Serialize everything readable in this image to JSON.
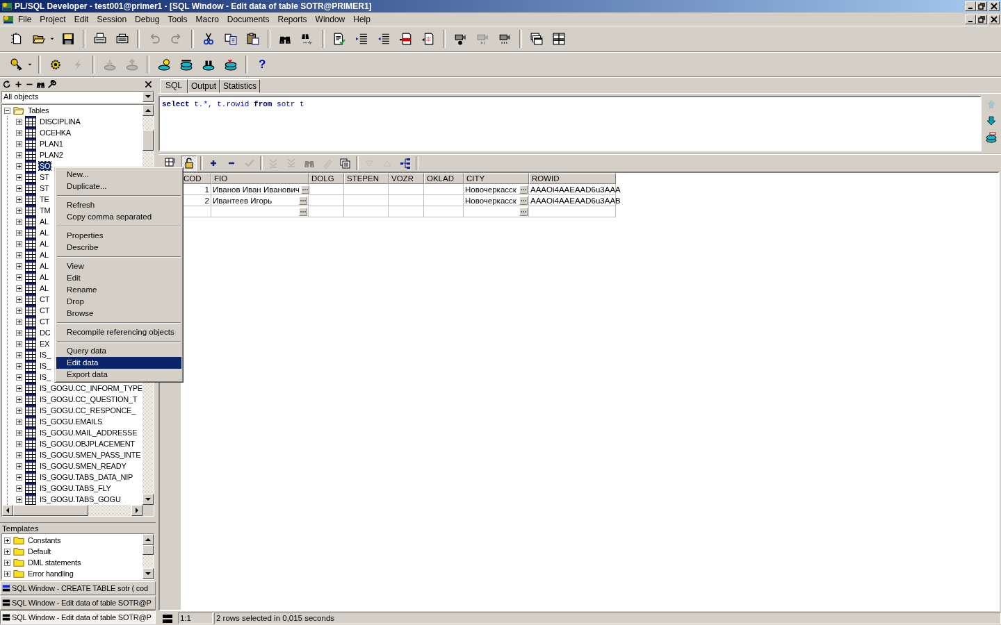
{
  "window": {
    "title": "PL/SQL Developer - test001@primer1 - [SQL Window - Edit data of table SOTR@PRIMER1]"
  },
  "menu": [
    {
      "label": "File"
    },
    {
      "label": "Project"
    },
    {
      "label": "Edit"
    },
    {
      "label": "Session"
    },
    {
      "label": "Debug"
    },
    {
      "label": "Tools"
    },
    {
      "label": "Macro"
    },
    {
      "label": "Documents"
    },
    {
      "label": "Reports"
    },
    {
      "label": "Window"
    },
    {
      "label": "Help"
    }
  ],
  "toolbar_1": [
    [
      {
        "disabled": false
      },
      {
        "disabled": false
      },
      {
        "disabled": false
      },
      {
        "disabled": false
      }
    ],
    [
      {
        "disabled": false
      },
      {
        "disabled": false
      }
    ],
    [
      {
        "disabled": true
      },
      {
        "disabled": true
      }
    ],
    [
      {
        "disabled": false
      },
      {
        "disabled": false
      },
      {
        "disabled": false
      }
    ],
    [
      {
        "disabled": false
      },
      {
        "disabled": false
      }
    ],
    [
      {
        "disabled": false
      },
      {
        "disabled": false
      },
      {
        "disabled": false
      },
      {
        "disabled": false
      },
      {
        "disabled": false
      }
    ],
    [
      {
        "disabled": false
      },
      {
        "disabled": true
      },
      {
        "disabled": false
      }
    ],
    [
      {
        "disabled": false
      },
      {
        "disabled": false
      }
    ]
  ],
  "toolbar_2": [
    [
      {
        "disabled": false
      },
      {
        "disabled": false
      }
    ],
    [
      {
        "disabled": false
      },
      {
        "disabled": true
      }
    ],
    [
      {
        "disabled": true
      },
      {
        "disabled": true
      }
    ],
    [
      {
        "disabled": false
      },
      {
        "disabled": false
      },
      {
        "disabled": false
      },
      {
        "disabled": false
      }
    ]
  ],
  "help_button": "?",
  "browser": {
    "filter": "All objects",
    "tree": [
      {
        "label": "Tables",
        "expanded": true,
        "children": [
          {
            "label": "DISCIPLINA",
            "expanded": false,
            "selected": false
          },
          {
            "label": "OCEHKA",
            "expanded": false,
            "selected": false
          },
          {
            "label": "PLAN1",
            "expanded": false,
            "selected": false
          },
          {
            "label": "PLAN2",
            "expanded": false,
            "selected": false
          },
          {
            "label": "SO",
            "expanded": false,
            "selected": true
          },
          {
            "label": "ST",
            "expanded": false,
            "selected": false
          },
          {
            "label": "ST",
            "expanded": false,
            "selected": false
          },
          {
            "label": "TE",
            "expanded": false,
            "selected": false
          },
          {
            "label": "TM",
            "expanded": false,
            "selected": false
          },
          {
            "label": "AL",
            "expanded": false,
            "selected": false
          },
          {
            "label": "AL",
            "expanded": false,
            "selected": false
          },
          {
            "label": "AL",
            "expanded": false,
            "selected": false
          },
          {
            "label": "AL",
            "expanded": false,
            "selected": false
          },
          {
            "label": "AL",
            "expanded": false,
            "selected": false
          },
          {
            "label": "AL",
            "expanded": false,
            "selected": false
          },
          {
            "label": "AL",
            "expanded": false,
            "selected": false
          },
          {
            "label": "CT",
            "expanded": false,
            "selected": false
          },
          {
            "label": "CT",
            "expanded": false,
            "selected": false
          },
          {
            "label": "CT",
            "expanded": false,
            "selected": false
          },
          {
            "label": "DC",
            "expanded": false,
            "selected": false
          },
          {
            "label": "EX",
            "expanded": false,
            "selected": false
          },
          {
            "label": "IS_",
            "expanded": false,
            "selected": false
          },
          {
            "label": "IS_",
            "expanded": false,
            "selected": false
          },
          {
            "label": "IS_",
            "expanded": false,
            "selected": false
          },
          {
            "label": "IS_GOGU.CC_INFORM_TYPE",
            "expanded": false,
            "selected": false
          },
          {
            "label": "IS_GOGU.CC_QUESTION_T",
            "expanded": false,
            "selected": false
          },
          {
            "label": "IS_GOGU.CC_RESPONCE_",
            "expanded": false,
            "selected": false
          },
          {
            "label": "IS_GOGU.EMAILS",
            "expanded": false,
            "selected": false
          },
          {
            "label": "IS_GOGU.MAIL_ADDRESSE",
            "expanded": false,
            "selected": false
          },
          {
            "label": "IS_GOGU.OBJPLACEMENT",
            "expanded": false,
            "selected": false
          },
          {
            "label": "IS_GOGU.SMEN_PASS_INTE",
            "expanded": false,
            "selected": false
          },
          {
            "label": "IS_GOGU.SMEN_READY",
            "expanded": false,
            "selected": false
          },
          {
            "label": "IS_GOGU.TABS_DATA_NIP",
            "expanded": false,
            "selected": false
          },
          {
            "label": "IS_GOGU.TABS_FLY",
            "expanded": false,
            "selected": false
          },
          {
            "label": "IS_GOGU.TABS_GOGU",
            "expanded": false,
            "selected": false
          }
        ]
      }
    ]
  },
  "context_menu": [
    [
      {
        "label": "New...",
        "selected": false
      },
      {
        "label": "Duplicate...",
        "selected": false
      }
    ],
    [
      {
        "label": "Refresh",
        "selected": false
      },
      {
        "label": "Copy comma separated",
        "selected": false
      }
    ],
    [
      {
        "label": "Properties",
        "selected": false
      },
      {
        "label": "Describe",
        "selected": false
      }
    ],
    [
      {
        "label": "View",
        "selected": false
      },
      {
        "label": "Edit",
        "selected": false
      },
      {
        "label": "Rename",
        "selected": false
      },
      {
        "label": "Drop",
        "selected": false
      },
      {
        "label": "Browse",
        "selected": false
      }
    ],
    [
      {
        "label": "Recompile referencing objects",
        "selected": false
      }
    ],
    [
      {
        "label": "Query data",
        "selected": false
      },
      {
        "label": "Edit data",
        "selected": true
      },
      {
        "label": "Export data",
        "selected": false
      }
    ]
  ],
  "templates": {
    "title": "Templates",
    "items": [
      {
        "label": "Constants",
        "expanded": false
      },
      {
        "label": "Default",
        "expanded": false
      },
      {
        "label": "DML statements",
        "expanded": false
      },
      {
        "label": "Error handling",
        "expanded": false
      }
    ]
  },
  "window_list": [
    {
      "label": "SQL Window - CREATE TABLE sotr ( cod",
      "selected": false,
      "active": true
    },
    {
      "label": "SQL Window - Edit data of table SOTR@P",
      "selected": false,
      "active": false
    },
    {
      "label": "SQL Window - Edit data of table SOTR@P",
      "selected": true,
      "active": false
    }
  ],
  "tabs": [
    {
      "label": "SQL",
      "selected": true
    },
    {
      "label": "Output",
      "selected": false
    },
    {
      "label": "Statistics",
      "selected": false
    }
  ],
  "editor": {
    "code": "**select** t.*, t.rowid **from** sotr t"
  },
  "grid_toolbar": [
    {
      "disabled": false,
      "pressed": false
    },
    {
      "disabled": false,
      "pressed": true
    },
    {
      "disabled": false,
      "pressed": false
    },
    {
      "disabled": false,
      "pressed": false
    },
    {
      "disabled": true,
      "pressed": false
    },
    {
      "disabled": true,
      "pressed": false
    },
    {
      "disabled": true,
      "pressed": false
    },
    {
      "disabled": true,
      "pressed": false
    },
    {
      "disabled": true,
      "pressed": false
    },
    {
      "disabled": false,
      "pressed": false
    },
    {
      "disabled": true,
      "pressed": false
    },
    {
      "disabled": true,
      "pressed": false
    },
    {
      "disabled": false,
      "pressed": false
    }
  ],
  "grid": {
    "columns": [
      {
        "label": "COD",
        "has_button": false
      },
      {
        "label": "FIO",
        "has_button": true
      },
      {
        "label": "DOLG",
        "has_button": false
      },
      {
        "label": "STEPEN",
        "has_button": false
      },
      {
        "label": "VOZR",
        "has_button": false
      },
      {
        "label": "OKLAD",
        "has_button": false
      },
      {
        "label": "CITY",
        "has_button": true
      },
      {
        "label": "ROWID",
        "has_button": false
      }
    ],
    "rows": [
      [
        "1",
        "Иванов Иван Иванович",
        "",
        "",
        "",
        "",
        "Новочеркасск",
        "AAAOi4AAEAAD6u3AAA"
      ],
      [
        "2",
        "Ивантеев Игорь",
        "",
        "",
        "",
        "",
        "Новочеркасск",
        "AAAOi4AAEAAD6u3AAB"
      ],
      [
        "",
        "",
        "",
        "",
        "",
        "",
        "",
        ""
      ]
    ]
  },
  "status_bar": {
    "position": "1:1",
    "message": "2 rows selected in 0,015 seconds"
  }
}
